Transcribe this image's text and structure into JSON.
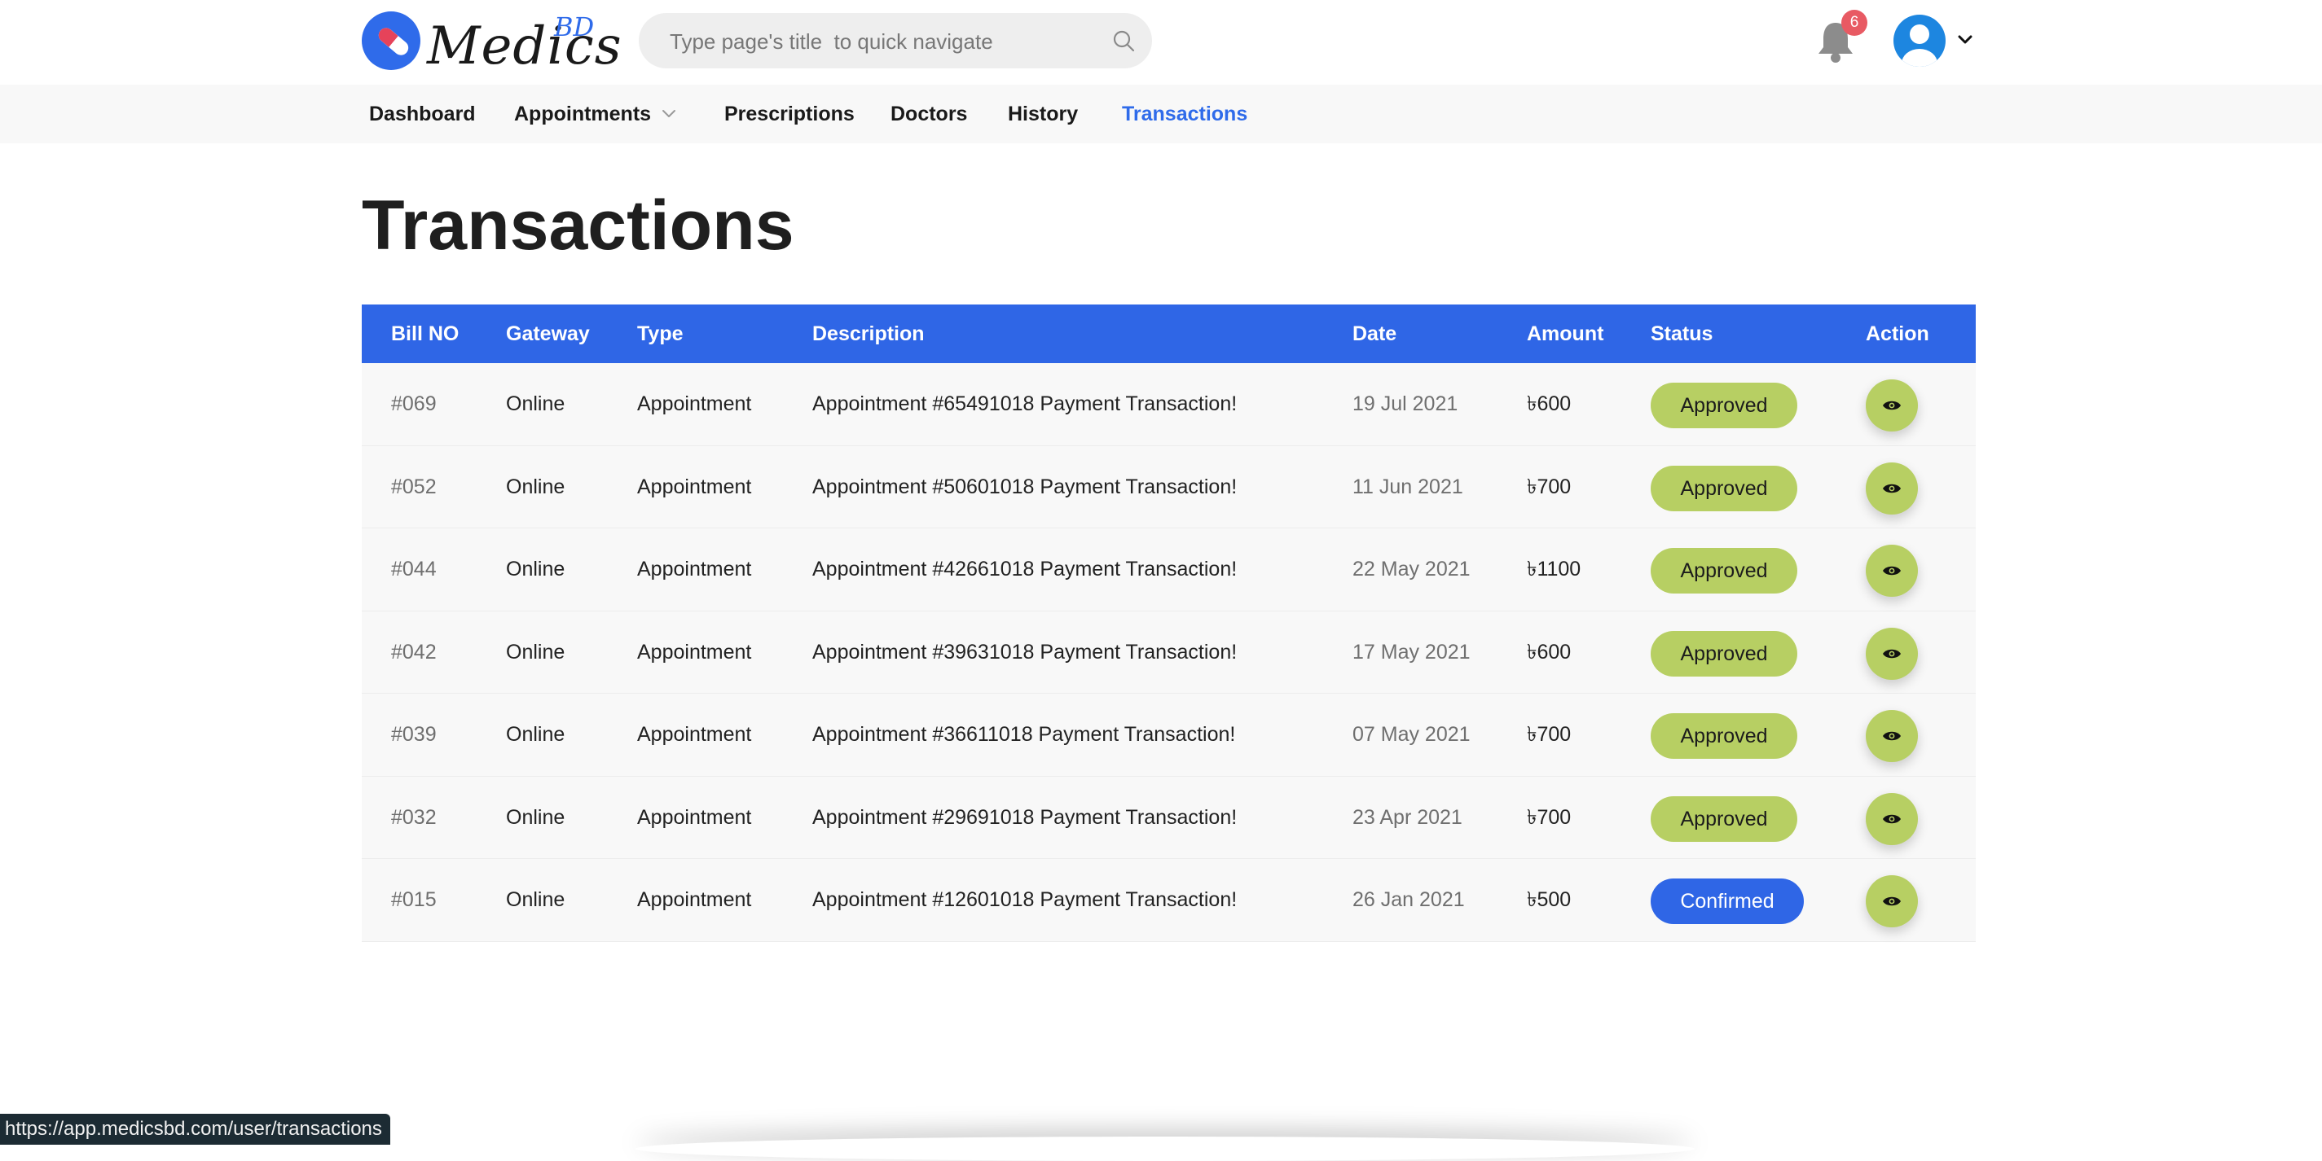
{
  "brand": {
    "name": "Medics",
    "suffix": "BD",
    "icon": "capsule-pill-icon",
    "color": "#2f6bea"
  },
  "search": {
    "placeholder": "Type page's title  to quick navigate",
    "icon": "search-icon"
  },
  "notifications": {
    "count": "6",
    "icon": "bell-icon"
  },
  "user": {
    "icon": "user-avatar-icon"
  },
  "nav": {
    "items": [
      {
        "label": "Dashboard"
      },
      {
        "label": "Appointments",
        "has_dropdown": true
      },
      {
        "label": "Prescriptions"
      },
      {
        "label": "Doctors"
      },
      {
        "label": "History"
      },
      {
        "label": "Transactions",
        "active": true
      }
    ]
  },
  "page": {
    "title": "Transactions"
  },
  "table": {
    "headers": [
      "Bill NO",
      "Gateway",
      "Type",
      "Description",
      "Date",
      "Amount",
      "Status",
      "Action"
    ],
    "rows": [
      {
        "bill": "#069",
        "gateway": "Online",
        "type": "Appointment",
        "description": "Appointment #65491018 Payment Transaction!",
        "date": "19 Jul 2021",
        "amount": "৳600",
        "status": "Approved"
      },
      {
        "bill": "#052",
        "gateway": "Online",
        "type": "Appointment",
        "description": "Appointment #50601018 Payment Transaction!",
        "date": "11 Jun 2021",
        "amount": "৳700",
        "status": "Approved"
      },
      {
        "bill": "#044",
        "gateway": "Online",
        "type": "Appointment",
        "description": "Appointment #42661018 Payment Transaction!",
        "date": "22 May 2021",
        "amount": "৳1100",
        "status": "Approved"
      },
      {
        "bill": "#042",
        "gateway": "Online",
        "type": "Appointment",
        "description": "Appointment #39631018 Payment Transaction!",
        "date": "17 May 2021",
        "amount": "৳600",
        "status": "Approved"
      },
      {
        "bill": "#039",
        "gateway": "Online",
        "type": "Appointment",
        "description": "Appointment #36611018 Payment Transaction!",
        "date": "07 May 2021",
        "amount": "৳700",
        "status": "Approved"
      },
      {
        "bill": "#032",
        "gateway": "Online",
        "type": "Appointment",
        "description": "Appointment #29691018 Payment Transaction!",
        "date": "23 Apr 2021",
        "amount": "৳700",
        "status": "Approved"
      },
      {
        "bill": "#015",
        "gateway": "Online",
        "type": "Appointment",
        "description": "Appointment #12601018 Payment Transaction!",
        "date": "26 Jan 2021",
        "amount": "৳500",
        "status": "Confirmed"
      }
    ],
    "action_icon": "eye-icon"
  },
  "colors": {
    "header_blue": "#2f66e6",
    "approved": "#b7cf63",
    "confirmed": "#2f66e6",
    "active_nav": "#2f6bea"
  },
  "statusbar": {
    "url": "https://app.medicsbd.com/user/transactions"
  }
}
